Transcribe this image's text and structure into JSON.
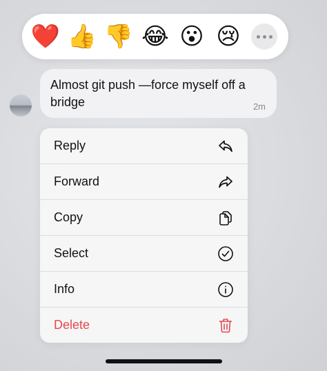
{
  "reactions": [
    {
      "name": "heart",
      "glyph": "❤️"
    },
    {
      "name": "thumbs-up",
      "glyph": "👍"
    },
    {
      "name": "thumbs-down",
      "glyph": "👎"
    },
    {
      "name": "laughing",
      "glyph": "😂"
    },
    {
      "name": "surprised",
      "glyph": "😮"
    },
    {
      "name": "crying",
      "glyph": "😢"
    }
  ],
  "more_icon": "ellipsis-icon",
  "message": {
    "text": "Almost git push —force myself off a bridge",
    "time": "2m"
  },
  "menu": {
    "items": [
      {
        "label": "Reply",
        "icon": "reply-icon"
      },
      {
        "label": "Forward",
        "icon": "forward-icon"
      },
      {
        "label": "Copy",
        "icon": "copy-icon"
      },
      {
        "label": "Select",
        "icon": "checkmark-circle-icon"
      },
      {
        "label": "Info",
        "icon": "info-icon"
      },
      {
        "label": "Delete",
        "icon": "trash-icon"
      }
    ]
  },
  "colors": {
    "danger": "#e5484d",
    "bubble": "#f2f2f4",
    "menu": "#f6f6f7"
  }
}
